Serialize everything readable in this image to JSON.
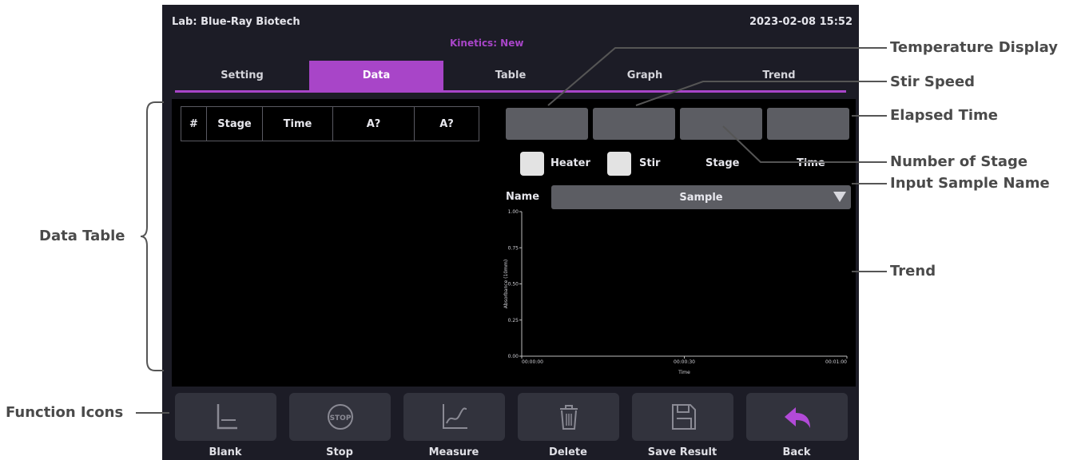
{
  "header": {
    "lab": "Lab: Blue-Ray Biotech",
    "datetime": "2023-02-08 15:52",
    "mode": "Kinetics: New"
  },
  "tabs": [
    {
      "label": "Setting",
      "active": false
    },
    {
      "label": "Data",
      "active": true
    },
    {
      "label": "Table",
      "active": false
    },
    {
      "label": "Graph",
      "active": false
    },
    {
      "label": "Trend",
      "active": false
    }
  ],
  "table": {
    "columns": [
      "#",
      "Stage",
      "Time",
      "A?",
      "A?"
    ],
    "rows": []
  },
  "status": {
    "heater_label": "Heater",
    "stir_label": "Stir",
    "stage_label": "Stage",
    "time_label": "Time",
    "heater_checked": false,
    "stir_checked": false
  },
  "name_field": {
    "label": "Name",
    "value": "Sample"
  },
  "chart_data": {
    "type": "line",
    "title": "",
    "xlabel": "Time",
    "ylabel": "Absorbance (10mm)",
    "x_ticks": [
      "00:00:00",
      "00:00:30",
      "00:01:00"
    ],
    "y_ticks": [
      "0.00",
      "0.25",
      "0.50",
      "0.75",
      "1.00"
    ],
    "ylim": [
      0,
      1
    ],
    "series": []
  },
  "buttons": [
    {
      "label": "Blank",
      "icon": "blank-icon"
    },
    {
      "label": "Stop",
      "icon": "stop-icon"
    },
    {
      "label": "Measure",
      "icon": "measure-icon"
    },
    {
      "label": "Delete",
      "icon": "trash-icon"
    },
    {
      "label": "Save Result",
      "icon": "save-icon"
    },
    {
      "label": "Back",
      "icon": "back-arrow-icon"
    }
  ],
  "annotations": {
    "temperature_display": "Temperature Display",
    "stir_speed": "Stir Speed",
    "elapsed_time": "Elapsed Time",
    "number_of_stage": "Number of Stage",
    "input_sample_name": "Input Sample Name",
    "trend": "Trend",
    "data_table": "Data Table",
    "function_icons": "Function Icons"
  },
  "colors": {
    "accent": "#a845c8",
    "screen_bg": "#1c1c26",
    "field_bg": "#5c5d63",
    "back_arrow": "#b24ad8"
  }
}
